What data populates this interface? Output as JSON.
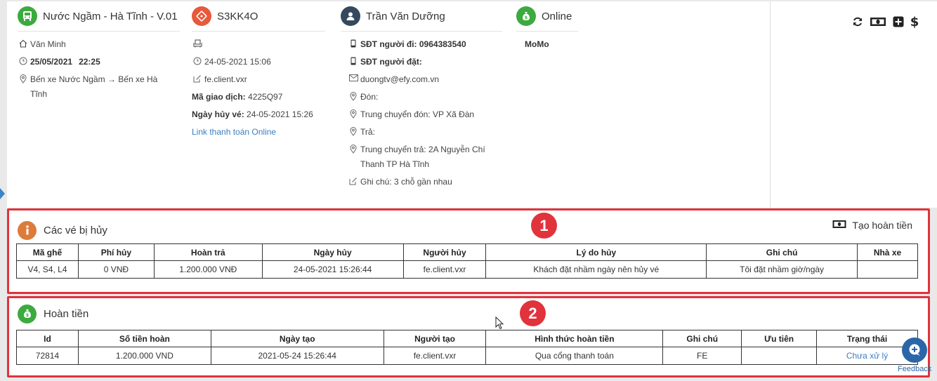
{
  "trip": {
    "route_title": "Nước Ngầm - Hà Tĩnh - V.01",
    "driver": "Văn Minh",
    "date": "25/05/2021",
    "time": "22:25",
    "route_path": "Bến xe Nước Ngầm → Bến xe Hà Tĩnh"
  },
  "ticket": {
    "code": "S3KK4O",
    "created_at": "24-05-2021 15:06",
    "created_by": "fe.client.vxr",
    "transaction_label": "Mã giao dịch:",
    "transaction_value": "4225Q97",
    "cancel_label": "Ngày hủy vé:",
    "cancel_value": "24-05-2021 15:26",
    "payment_link": "Link thanh toán Online"
  },
  "customer": {
    "name": "Trần Văn Dưỡng",
    "phone_traveler": "SĐT người đi: 0964383540",
    "phone_booker": "SĐT người đặt:",
    "email": "duongtv@efy.com.vn",
    "pickup": "Đón:",
    "pickup_transfer": "Trung chuyển đón: VP Xã Đàn",
    "dropoff": "Trả:",
    "dropoff_transfer": "Trung chuyển trả: 2A Nguyễn Chí Thanh TP Hà Tĩnh",
    "note": "Ghi chú: 3 chỗ gần nhau"
  },
  "payment": {
    "status": "Online",
    "method": "MoMo"
  },
  "toolbar_icons": [
    "refresh-icon",
    "cash-icon",
    "plus-square-icon",
    "dollar-icon"
  ],
  "cancelled": {
    "title": "Các vé bị hủy",
    "badge": "1",
    "create_refund": "Tạo hoàn tiền",
    "headers": [
      "Mã ghế",
      "Phí hủy",
      "Hoàn trả",
      "Ngày hủy",
      "Người hủy",
      "Lý do hủy",
      "Ghi chú",
      "Nhà xe"
    ],
    "rows": [
      [
        "V4, S4, L4",
        "0 VNĐ",
        "1.200.000 VNĐ",
        "24-05-2021 15:26:44",
        "fe.client.vxr",
        "Khách đặt nhầm ngày nên hủy vé",
        "Tôi đặt nhầm giờ/ngày",
        ""
      ]
    ]
  },
  "refund": {
    "title": "Hoàn tiền",
    "badge": "2",
    "headers": [
      "Id",
      "Số tiền hoàn",
      "Ngày tạo",
      "Người tạo",
      "Hình thức hoàn tiền",
      "Ghi chú",
      "Ưu tiên",
      "Trạng thái"
    ],
    "rows": [
      [
        "72814",
        "1.200.000 VND",
        "2021-05-24 15:26:44",
        "fe.client.vxr",
        "Qua cổng thanh toán",
        "FE",
        "",
        "Chưa xử lý"
      ]
    ]
  },
  "feedback_label": "Feedback",
  "colors": {
    "green": "#3daa3f",
    "orange_red": "#e8583a",
    "navy": "#34495e",
    "info_orange": "#dd7c3a",
    "highlight_red": "#e0333c",
    "link_blue": "#3a7fc0"
  }
}
